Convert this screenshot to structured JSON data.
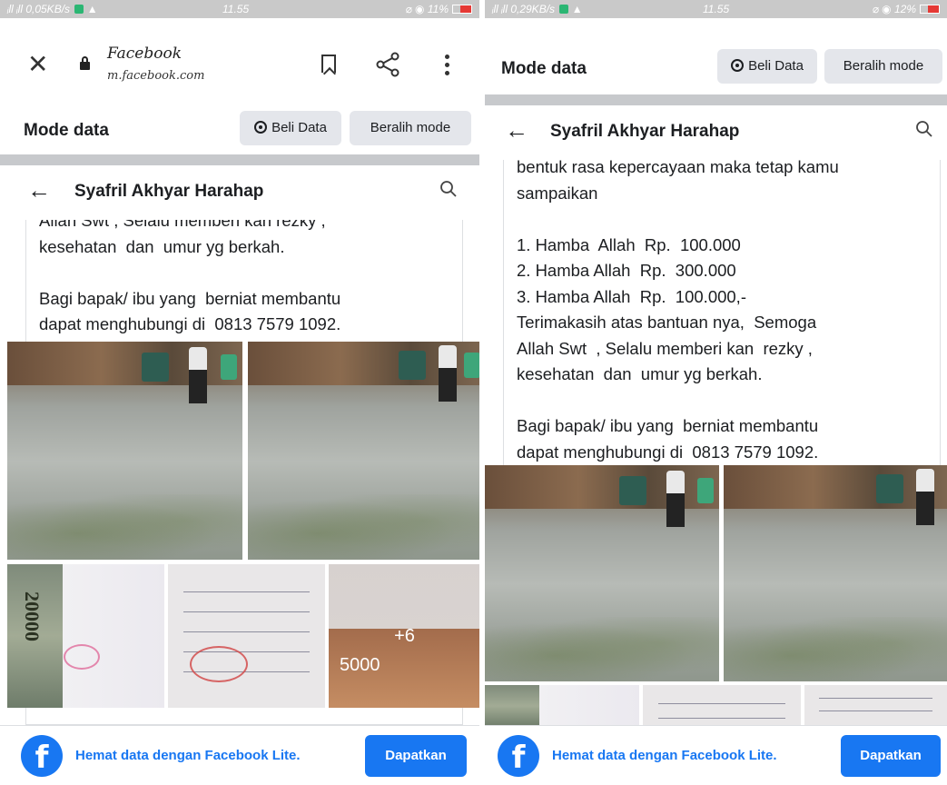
{
  "left": {
    "status": {
      "left": "0,05KB/s",
      "time": "11.55",
      "battery": "11%"
    },
    "browser": {
      "title": "Facebook",
      "url": "m.facebook.com"
    },
    "mode_bar": {
      "title": "Mode data",
      "buy_label": "Beli Data",
      "switch_label": "Beralih mode"
    },
    "profile_name": "Syafril Akhyar Harahap",
    "post_text": "Allah Swt , Selalu memberi kan rezky ,\nkesehatan  dan  umur yg berkah.\n\nBagi bapak/ ibu yang  berniat membantu\ndapat menghubungi di  0813 7579 1092.",
    "photo_more": "+6",
    "photo_labels": {
      "money": "20000",
      "note": "5000"
    },
    "banner": {
      "text": "Hemat data dengan Facebook Lite.",
      "button": "Dapatkan"
    }
  },
  "right": {
    "status": {
      "left": "0,29KB/s",
      "time": "11.55",
      "battery": "12%"
    },
    "mode_bar": {
      "title": "Mode data",
      "buy_label": "Beli Data",
      "switch_label": "Beralih mode"
    },
    "profile_name": "Syafril Akhyar Harahap",
    "post_text": "bentuk rasa kepercayaan maka tetap kamu\nsampaikan\n\n1. Hamba  Allah  Rp.  100.000\n2. Hamba Allah  Rp.  300.000\n3. Hamba Allah  Rp.  100.000,-\nTerimakasih atas bantuan nya,  Semoga\nAllah Swt  , Selalu memberi kan  rezky ,\nkesehatan  dan  umur yg berkah.\n\nBagi bapak/ ibu yang  berniat membantu\ndapat menghubungi di  0813 7579 1092.",
    "banner": {
      "text": "Hemat data dengan Facebook Lite.",
      "button": "Dapatkan"
    }
  },
  "icons": {
    "close": "close-icon",
    "lock": "lock-icon",
    "bookmark": "bookmark-icon",
    "share": "share-icon",
    "more": "more-vertical-icon",
    "back": "back-arrow-icon",
    "search": "search-icon",
    "buy": "beli-data-icon",
    "facebook": "facebook-logo-icon"
  },
  "colors": {
    "brand_blue": "#1877f2",
    "gray_button": "#e4e6eb",
    "divider": "#c7c9cc",
    "status_bar": "#c9c9c9"
  }
}
